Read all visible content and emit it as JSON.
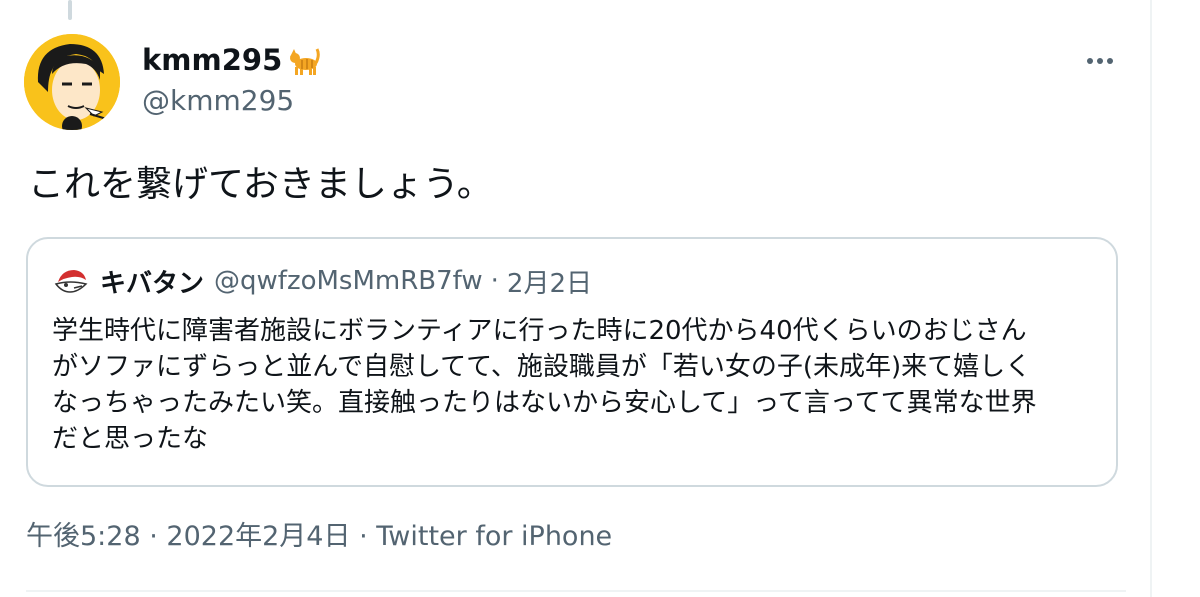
{
  "author": {
    "display_name": "kmm295",
    "handle": "@kmm295",
    "name_emoji_icon": "cat-icon"
  },
  "tweet": {
    "text": "これを繋げておきましょう。"
  },
  "quote": {
    "name": "キバタン",
    "handle": "@qwfzoMsMmRB7fw",
    "separator": "·",
    "date": "2月2日",
    "lines": [
      "学生時代に障害者施設にボランティアに行った時に20代から40代くらいのおじさん",
      "がソファにずらっと並んで自慰してて、施設職員が「若い女の子(未成年)来て嬉しく",
      "なっちゃったみたい笑。直接触ったりはないから安心して」って言ってて異常な世界",
      "だと思ったな"
    ]
  },
  "meta": {
    "time": "午後5:28",
    "sep1": "·",
    "date": "2022年2月4日",
    "sep2": "·",
    "source": "Twitter for iPhone"
  },
  "icons": {
    "more": "more-horizontal-icon"
  },
  "colors": {
    "text_primary": "#0f1419",
    "text_secondary": "#536471",
    "border": "#cfd9de",
    "avatar_bg": "#f9c21b"
  }
}
